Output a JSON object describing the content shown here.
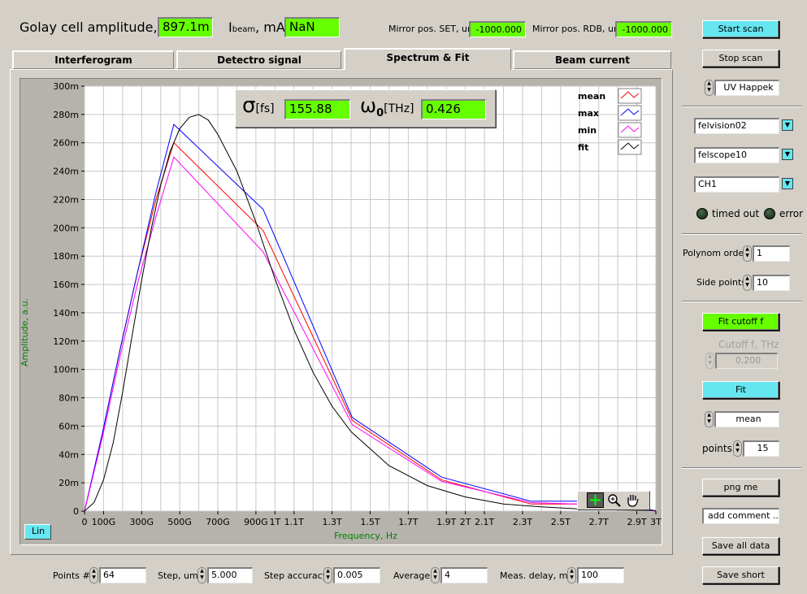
{
  "header": {
    "golay_label": "Golay cell amplitude, V",
    "golay_value": "897.1m",
    "ibeam_label_main": "I",
    "ibeam_label_sub": "beam",
    "ibeam_label_unit": ", mA",
    "ibeam_value": "NaN",
    "mirror_set_label": "Mirror pos. SET, um",
    "mirror_set_value": "-1000.000",
    "mirror_rdb_label": "Mirror pos. RDB, um",
    "mirror_rdb_value": "-1000.000"
  },
  "tabs": [
    {
      "label": "Interferogram",
      "active": false
    },
    {
      "label": "Detectro signal",
      "active": false
    },
    {
      "label": "Spectrum & Fit",
      "active": true
    },
    {
      "label": "Beam current",
      "active": false
    }
  ],
  "fit_box": {
    "sigma_symbol": "σ",
    "sigma_unit": "[fs]",
    "sigma_value": "155.88",
    "omega_symbol": "ω",
    "omega_sub": "0",
    "omega_unit": "[THz]",
    "omega_value": "0.426"
  },
  "scale_button": "Lin",
  "tool_icons": [
    "crosshair-icon",
    "zoom-icon",
    "pan-hand-icon"
  ],
  "chart_data": {
    "type": "line",
    "xlabel": "Frequency, Hz",
    "ylabel": "Amplitude, a.u.",
    "x_ticks": [
      "0",
      "100G",
      "300G",
      "500G",
      "700G",
      "900G",
      "1T",
      "1.1T",
      "1.3T",
      "1.5T",
      "1.7T",
      "1.9T",
      "2T",
      "2.1T",
      "2.3T",
      "2.5T",
      "2.7T",
      "2.9T",
      "3T"
    ],
    "x_tick_values": [
      0,
      0.1,
      0.3,
      0.5,
      0.7,
      0.9,
      1.0,
      1.1,
      1.3,
      1.5,
      1.7,
      1.9,
      2.0,
      2.1,
      2.3,
      2.5,
      2.7,
      2.9,
      3.0
    ],
    "y_ticks": [
      "0",
      "20m",
      "40m",
      "60m",
      "80m",
      "100m",
      "120m",
      "140m",
      "160m",
      "180m",
      "200m",
      "220m",
      "240m",
      "260m",
      "280m",
      "300m"
    ],
    "xlim": [
      0,
      3.0
    ],
    "ylim": [
      0,
      0.3
    ],
    "grid": true,
    "legend_position": "top-right",
    "background": "#ffffff",
    "series": [
      {
        "name": "mean",
        "color": "#ff0000",
        "x": [
          0,
          0.094,
          0.188,
          0.281,
          0.375,
          0.469,
          0.938,
          1.406,
          1.875,
          2.344,
          2.813,
          3.0
        ],
        "y": [
          0,
          0.055,
          0.115,
          0.17,
          0.22,
          0.26,
          0.198,
          0.064,
          0.022,
          0.005,
          0.005,
          0
        ]
      },
      {
        "name": "max",
        "color": "#0000ff",
        "x": [
          0,
          0.094,
          0.188,
          0.281,
          0.375,
          0.469,
          0.938,
          1.406,
          1.875,
          2.344,
          2.813,
          3.0
        ],
        "y": [
          0,
          0.055,
          0.115,
          0.17,
          0.225,
          0.273,
          0.213,
          0.066,
          0.024,
          0.007,
          0.007,
          0
        ]
      },
      {
        "name": "min",
        "color": "#ff00ff",
        "x": [
          0,
          0.094,
          0.188,
          0.281,
          0.375,
          0.469,
          0.938,
          1.406,
          1.875,
          2.344,
          2.813,
          3.0
        ],
        "y": [
          0,
          0.052,
          0.11,
          0.162,
          0.208,
          0.25,
          0.183,
          0.061,
          0.021,
          0.006,
          0.004,
          0
        ]
      },
      {
        "name": "fit",
        "color": "#000000",
        "x": [
          0,
          0.05,
          0.1,
          0.15,
          0.2,
          0.25,
          0.3,
          0.35,
          0.4,
          0.45,
          0.5,
          0.55,
          0.6,
          0.65,
          0.7,
          0.8,
          0.9,
          1.0,
          1.1,
          1.2,
          1.3,
          1.4,
          1.6,
          1.8,
          2.0,
          2.2,
          2.4,
          2.6,
          2.8,
          3.0
        ],
        "y": [
          0,
          0.006,
          0.022,
          0.048,
          0.084,
          0.124,
          0.163,
          0.199,
          0.23,
          0.254,
          0.27,
          0.278,
          0.28,
          0.276,
          0.266,
          0.24,
          0.204,
          0.164,
          0.128,
          0.098,
          0.074,
          0.056,
          0.032,
          0.018,
          0.01,
          0.005,
          0.003,
          0.0015,
          0.0008,
          0.0004
        ]
      }
    ]
  },
  "right_panel": {
    "start_scan": "Start scan",
    "stop_scan": "Stop scan",
    "mode_select": "UV Happek",
    "device1": "felvision02",
    "device2": "felscope10",
    "channel": "CH1",
    "timed_out_label": "timed out",
    "error_label": "error",
    "polynom_label": "Polynom order",
    "polynom_value": "1",
    "side_points_label": "Side points",
    "side_points_value": "10",
    "fit_cutoff_button": "Fit cutoff f",
    "cutoff_label": "Cutoff f, THz",
    "cutoff_value": "0.200",
    "fit_button": "Fit",
    "stat_select": "mean",
    "points_label": "points",
    "points_value": "15",
    "png_button": "png me",
    "comment_placeholder": "add comment ...",
    "save_all_button": "Save all data",
    "save_short_button": "Save short"
  },
  "bottom_bar": {
    "points_label": "Points #",
    "points_value": "64",
    "step_label": "Step, um",
    "step_value": "5.000",
    "step_acc_label": "Step accuracy",
    "step_acc_value": "0.005",
    "average_label": "Average",
    "average_value": "4",
    "meas_delay_label": "Meas. delay, ms",
    "meas_delay_value": "100"
  }
}
